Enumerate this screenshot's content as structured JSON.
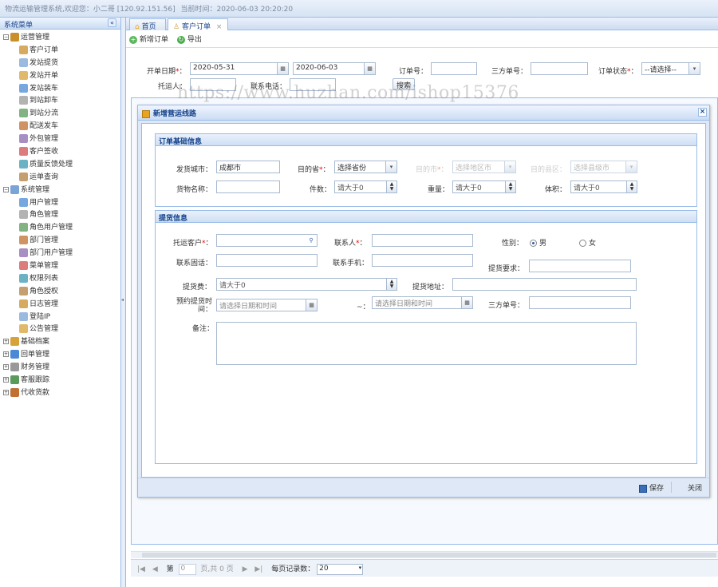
{
  "topbar": {
    "welcome": "物流运输管理系统,欢迎您：小二哥 [120.92.151.56]",
    "time_label": "当前时间：2020-06-03 20:20:20"
  },
  "sidebar": {
    "title": "系统菜单",
    "collapse": "«",
    "groups": [
      {
        "label": "运营管理",
        "children": [
          "客户订单",
          "发站提货",
          "发站开单",
          "发站装车",
          "到站卸车",
          "到站分流",
          "配送发车",
          "外包管理",
          "客户签收",
          "质量反馈处理",
          "运单查询"
        ]
      },
      {
        "label": "系统管理",
        "children": [
          "用户管理",
          "角色管理",
          "角色用户管理",
          "部门管理",
          "部门用户管理",
          "菜单管理",
          "权限列表",
          "角色授权",
          "日志管理",
          "登陆IP",
          "公告管理"
        ]
      },
      {
        "label": "基础档案",
        "children": []
      },
      {
        "label": "回单管理",
        "children": []
      },
      {
        "label": "财务管理",
        "children": []
      },
      {
        "label": "客服跟踪",
        "children": []
      },
      {
        "label": "代收货款",
        "children": []
      }
    ]
  },
  "tabs": {
    "home": "首页",
    "orders": "客户订单",
    "close": "×"
  },
  "toolbar": {
    "add": "新增订单",
    "export": "导出"
  },
  "search": {
    "date_label": "开单日期",
    "date_from": "2020-05-31",
    "date_to": "2020-06-03",
    "order_no_label": "订单号：",
    "third_no_label": "三方单号：",
    "status_label": "订单状态",
    "status_value": "--请选择--",
    "shipper_label": "托运人：",
    "phone_label": "联系电话：",
    "search_button": "搜索"
  },
  "watermark": "https://www.huzhan.com/ishop15376",
  "dialog": {
    "title": "新增营运线路",
    "close": "×",
    "section1": {
      "title": "订单基础信息",
      "from_city_label": "发货城市：",
      "from_city_value": "成都市",
      "dest_prov_label": "目的省",
      "dest_prov_value": "选择省份",
      "dest_city_label": "目的市",
      "dest_city_value": "选择地区市",
      "dest_county_label": "目的县区：",
      "dest_county_value": "选择县级市",
      "goods_label": "货物名称：",
      "pieces_label": "件数：",
      "pieces_ph": "请大于0",
      "weight_label": "重量：",
      "weight_ph": "请大于0",
      "volume_label": "体积：",
      "volume_ph": "请大于0"
    },
    "section2": {
      "title": "提货信息",
      "customer_label": "托运客户",
      "contact_label": "联系人",
      "gender_label": "性别：",
      "male": "男",
      "female": "女",
      "tel_label": "联系固话：",
      "mobile_label": "联系手机：",
      "req_label": "提货要求：",
      "fee_label": "提货费：",
      "fee_ph": "请大于0",
      "addr_label": "提货地址：",
      "time_label_1": "预约提货时",
      "time_label_2": "间：",
      "time_ph": "请选择日期和时间",
      "tilde": "~：",
      "third_label": "三方单号：",
      "remark_label": "备注："
    },
    "save": "保存",
    "close_btn": "关闭"
  },
  "pager": {
    "first": "|◀",
    "prev": "◀",
    "page_label": "第",
    "page_value": "0",
    "total": "页,共 0 页",
    "next": "▶",
    "last": "▶|",
    "per_page_label": "每页记录数：",
    "per_page_value": "20"
  }
}
